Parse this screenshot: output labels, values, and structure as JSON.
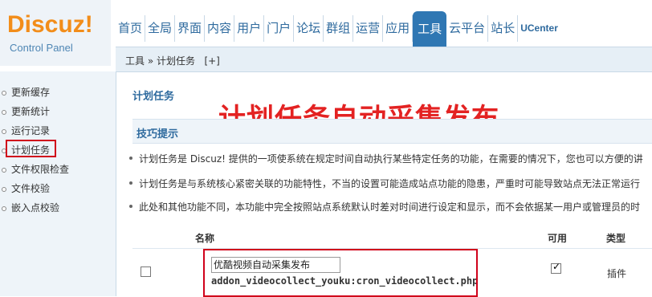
{
  "logo": {
    "brand": "Discuz!",
    "sub": "Control Panel"
  },
  "nav": {
    "items": [
      "首页",
      "全局",
      "界面",
      "内容",
      "用户",
      "门户",
      "论坛",
      "群组",
      "运营",
      "应用",
      "工具",
      "云平台",
      "站长",
      "UCenter"
    ],
    "active": "工具"
  },
  "breadcrumb": {
    "text": "工具 » 计划任务",
    "expand": "[+]"
  },
  "sidebar": {
    "items": [
      "更新缓存",
      "更新统计",
      "运行记录",
      "计划任务",
      "文件权限检查",
      "文件校验",
      "嵌入点校验"
    ],
    "active": "计划任务"
  },
  "main": {
    "title": "计划任务",
    "overlay_caption": "计划任务自动采集发布",
    "tips_title": "技巧提示",
    "tips": [
      "计划任务是 Discuz! 提供的一项使系统在规定时间自动执行某些特定任务的功能，在需要的情况下，您也可以方便的讲",
      "计划任务是与系统核心紧密关联的功能特性，不当的设置可能造成站点功能的隐患，严重时可能导致站点无法正常运行",
      "此处和其他功能不同，本功能中完全按照站点系统默认时差对时间进行设定和显示，而不会依据某一用户或管理员的时"
    ],
    "table": {
      "headers": {
        "name": "名称",
        "available": "可用",
        "type": "类型"
      },
      "rows": [
        {
          "name_value": "优酷视频自动采集发布",
          "file": "addon_videocollect_youku:cron_videocollect.php",
          "available": true,
          "available_mark": "✓",
          "type": "插件"
        }
      ]
    }
  },
  "colors": {
    "accent": "#2f77b3",
    "highlight": "#d0021b",
    "logo": "#f28d1a"
  }
}
